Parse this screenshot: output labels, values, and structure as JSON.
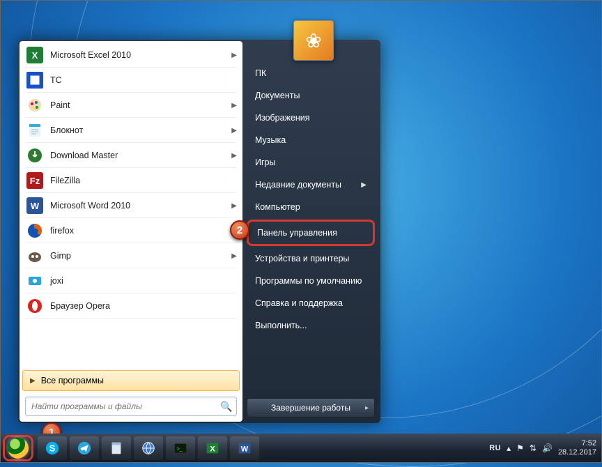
{
  "programs": [
    {
      "label": "Microsoft Excel 2010",
      "icon": "excel",
      "arrow": true
    },
    {
      "label": "TC",
      "icon": "tc",
      "arrow": false
    },
    {
      "label": "Paint",
      "icon": "paint",
      "arrow": true
    },
    {
      "label": "Блокнот",
      "icon": "notepad",
      "arrow": true
    },
    {
      "label": "Download Master",
      "icon": "dm",
      "arrow": true
    },
    {
      "label": "FileZilla",
      "icon": "fz",
      "arrow": false
    },
    {
      "label": "Microsoft Word 2010",
      "icon": "word",
      "arrow": true
    },
    {
      "label": "firefox",
      "icon": "ff",
      "arrow": false
    },
    {
      "label": "Gimp",
      "icon": "gimp",
      "arrow": true
    },
    {
      "label": "joxi",
      "icon": "joxi",
      "arrow": false
    },
    {
      "label": "Браузер Opera",
      "icon": "opera",
      "arrow": false
    }
  ],
  "all_programs": "Все программы",
  "search_placeholder": "Найти программы и файлы",
  "right_menu": [
    {
      "label": "ПК",
      "arrow": false,
      "key": "pc"
    },
    {
      "label": "Документы",
      "arrow": false,
      "key": "docs"
    },
    {
      "label": "Изображения",
      "arrow": false,
      "key": "pics"
    },
    {
      "label": "Музыка",
      "arrow": false,
      "key": "music"
    },
    {
      "label": "Игры",
      "arrow": false,
      "key": "games"
    },
    {
      "label": "Недавние документы",
      "arrow": true,
      "key": "recent"
    },
    {
      "label": "Компьютер",
      "arrow": false,
      "key": "computer"
    },
    {
      "label": "Панель управления",
      "arrow": false,
      "key": "cp",
      "highlight": true
    },
    {
      "label": "Устройства и принтеры",
      "arrow": false,
      "key": "devices"
    },
    {
      "label": "Программы по умолчанию",
      "arrow": false,
      "key": "defaults"
    },
    {
      "label": "Справка и поддержка",
      "arrow": false,
      "key": "help"
    },
    {
      "label": "Выполнить...",
      "arrow": false,
      "key": "run"
    }
  ],
  "shutdown": "Завершение работы",
  "tray": {
    "lang": "RU",
    "time": "7:52",
    "date": "28.12.2017"
  },
  "badges": {
    "1": "1",
    "2": "2"
  },
  "icons": {
    "excel": "#1e7e34",
    "tc": "#1952c6",
    "paint": "#e26a1a",
    "notepad": "#3fa9d6",
    "dm": "#2d7a33",
    "fz": "#b11a1a",
    "word": "#2a5699",
    "ff": "#e66000",
    "gimp": "#6b5b4a",
    "joxi": "#2aa5d9",
    "opera": "#e2231a"
  }
}
